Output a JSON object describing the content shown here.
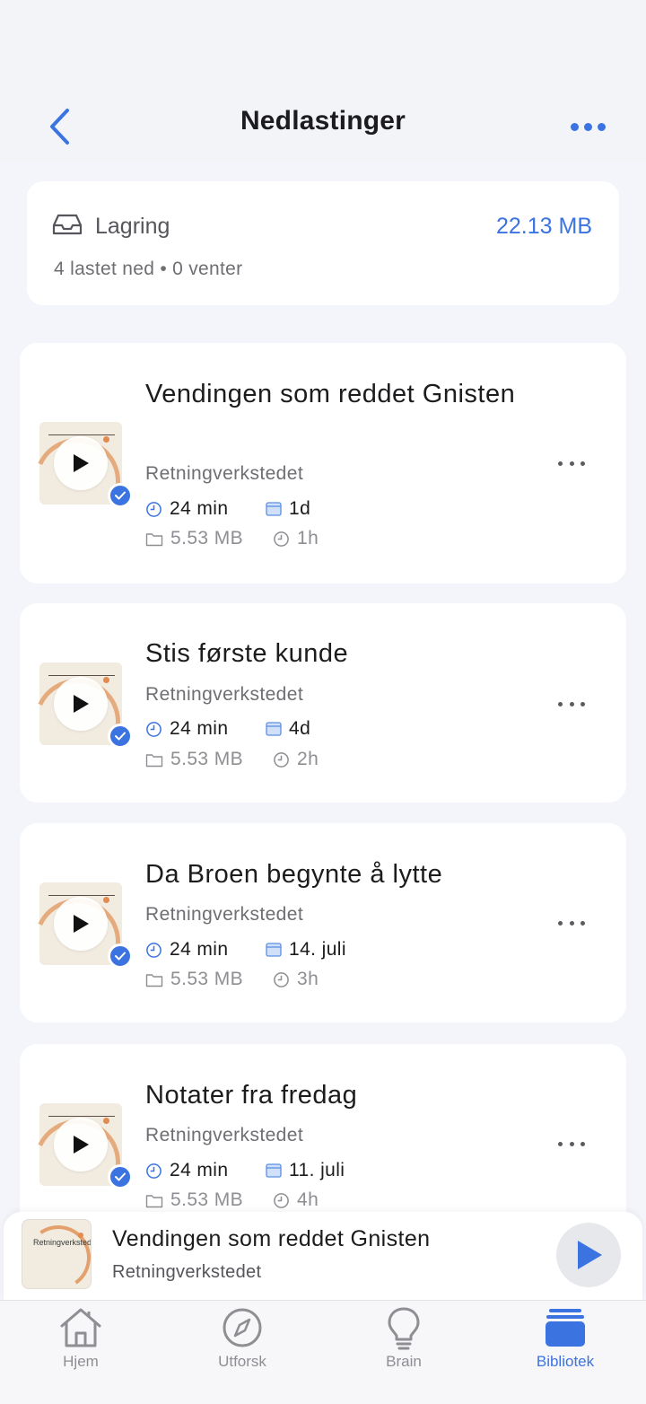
{
  "header": {
    "title": "Nedlastinger",
    "back_icon": "chevron-left-icon",
    "more_icon": "ellipsis-icon",
    "accent": "#3b74e0"
  },
  "storage": {
    "label": "Lagring",
    "size": "22.13 MB",
    "summary": "4 lastet ned • 0 venter",
    "icon": "tray-icon"
  },
  "episodes": [
    {
      "title": "Vendingen som reddet Gnisten",
      "show": "Retningverkstedet",
      "duration": "24 min",
      "date": "1d",
      "file_size": "5.53 MB",
      "age": "1h"
    },
    {
      "title": "Stis første kunde",
      "show": "Retningverkstedet",
      "duration": "24 min",
      "date": "4d",
      "file_size": "5.53 MB",
      "age": "2h"
    },
    {
      "title": "Da Broen begynte å lytte",
      "show": "Retningverkstedet",
      "duration": "24 min",
      "date": "14. juli",
      "file_size": "5.53 MB",
      "age": "3h"
    },
    {
      "title": "Notater fra fredag",
      "show": "Retningverkstedet",
      "duration": "24 min",
      "date": "11. juli",
      "file_size": "5.53 MB",
      "age": "4h"
    }
  ],
  "mini_player": {
    "title": "Vendingen som reddet Gnisten",
    "show": "Retningverkstedet",
    "thumb_text": "Retningverkstedet"
  },
  "tabs": [
    {
      "label": "Hjem",
      "icon": "home-icon",
      "active": false
    },
    {
      "label": "Utforsk",
      "icon": "compass-icon",
      "active": false
    },
    {
      "label": "Brain",
      "icon": "lightbulb-icon",
      "active": false
    },
    {
      "label": "Bibliotek",
      "icon": "library-icon",
      "active": true
    }
  ]
}
